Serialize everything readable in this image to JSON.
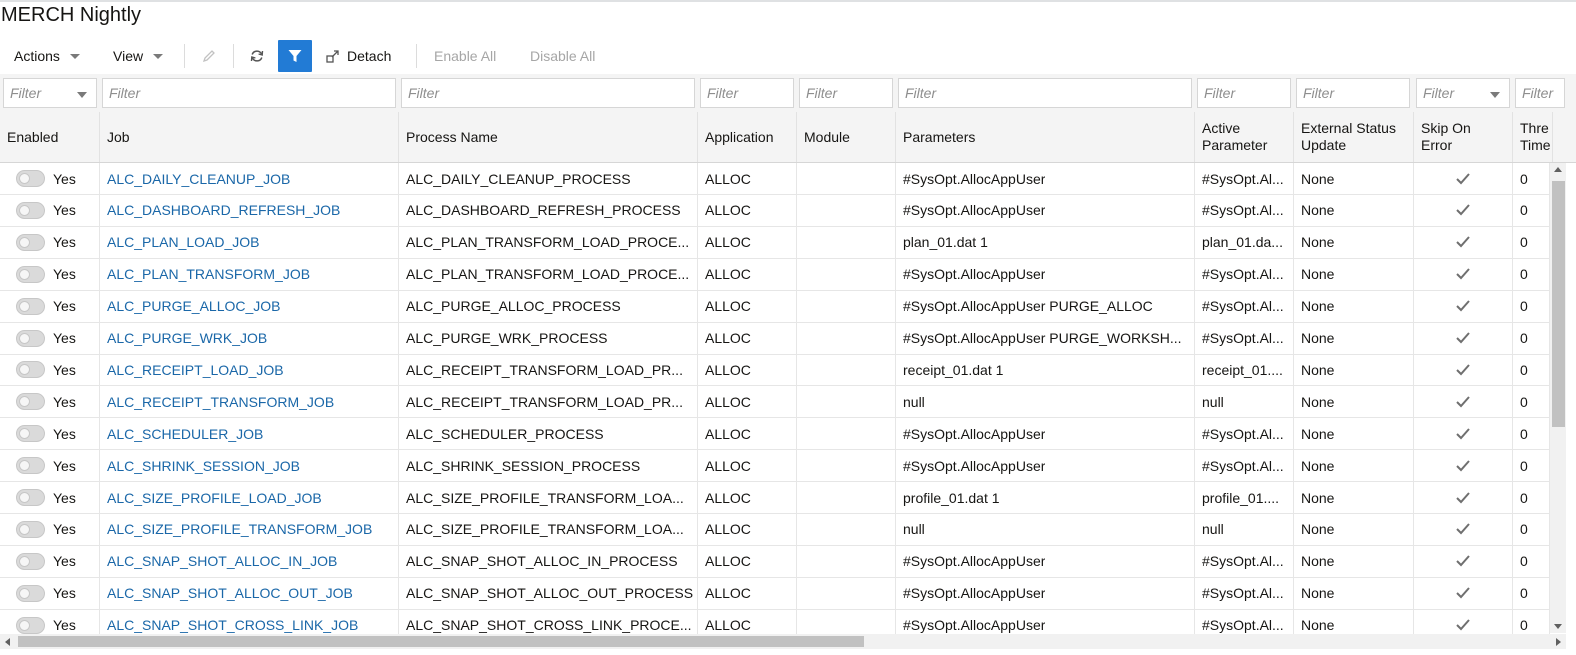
{
  "page": {
    "title": "MERCH Nightly"
  },
  "toolbar": {
    "actions_label": "Actions",
    "view_label": "View",
    "edit_icon": "pencil-icon",
    "refresh_icon": "refresh-icon",
    "filter_icon": "filter-icon",
    "detach_icon": "detach-icon",
    "detach_label": "Detach",
    "enable_all_label": "Enable All",
    "disable_all_label": "Disable All",
    "active_color": "#227bd5"
  },
  "filters": {
    "placeholder": "Filter"
  },
  "columns": {
    "enabled": "Enabled",
    "job": "Job",
    "process_name": "Process Name",
    "application": "Application",
    "module": "Module",
    "parameters": "Parameters",
    "active_parameter_1": "Active",
    "active_parameter_2": "Parameter",
    "external_status_1": "External Status",
    "external_status_2": "Update",
    "skip_on_error_1": "Skip On",
    "skip_on_error_2": "Error",
    "threshold_1": "Thre",
    "threshold_2": "Time"
  },
  "rows": [
    {
      "enabled": "Yes",
      "job": "ALC_DAILY_CLEANUP_JOB",
      "process": "ALC_DAILY_CLEANUP_PROCESS",
      "application": "ALLOC",
      "module": "",
      "parameters": "#SysOpt.AllocAppUser",
      "active_parameter": "#SysOpt.Al...",
      "external_status": "None",
      "skip_on_error": true,
      "threshold": "0"
    },
    {
      "enabled": "Yes",
      "job": "ALC_DASHBOARD_REFRESH_JOB",
      "process": "ALC_DASHBOARD_REFRESH_PROCESS",
      "application": "ALLOC",
      "module": "",
      "parameters": "#SysOpt.AllocAppUser",
      "active_parameter": "#SysOpt.Al...",
      "external_status": "None",
      "skip_on_error": true,
      "threshold": "0"
    },
    {
      "enabled": "Yes",
      "job": "ALC_PLAN_LOAD_JOB",
      "process": "ALC_PLAN_TRANSFORM_LOAD_PROCE...",
      "application": "ALLOC",
      "module": "",
      "parameters": "plan_01.dat 1",
      "active_parameter": "plan_01.da...",
      "external_status": "None",
      "skip_on_error": true,
      "threshold": "0"
    },
    {
      "enabled": "Yes",
      "job": "ALC_PLAN_TRANSFORM_JOB",
      "process": "ALC_PLAN_TRANSFORM_LOAD_PROCE...",
      "application": "ALLOC",
      "module": "",
      "parameters": "#SysOpt.AllocAppUser",
      "active_parameter": "#SysOpt.Al...",
      "external_status": "None",
      "skip_on_error": true,
      "threshold": "0"
    },
    {
      "enabled": "Yes",
      "job": "ALC_PURGE_ALLOC_JOB",
      "process": "ALC_PURGE_ALLOC_PROCESS",
      "application": "ALLOC",
      "module": "",
      "parameters": "#SysOpt.AllocAppUser PURGE_ALLOC",
      "active_parameter": "#SysOpt.Al...",
      "external_status": "None",
      "skip_on_error": true,
      "threshold": "0"
    },
    {
      "enabled": "Yes",
      "job": "ALC_PURGE_WRK_JOB",
      "process": "ALC_PURGE_WRK_PROCESS",
      "application": "ALLOC",
      "module": "",
      "parameters": "#SysOpt.AllocAppUser PURGE_WORKSH...",
      "active_parameter": "#SysOpt.Al...",
      "external_status": "None",
      "skip_on_error": true,
      "threshold": "0"
    },
    {
      "enabled": "Yes",
      "job": "ALC_RECEIPT_LOAD_JOB",
      "process": "ALC_RECEIPT_TRANSFORM_LOAD_PR...",
      "application": "ALLOC",
      "module": "",
      "parameters": "receipt_01.dat 1",
      "active_parameter": "receipt_01....",
      "external_status": "None",
      "skip_on_error": true,
      "threshold": "0"
    },
    {
      "enabled": "Yes",
      "job": "ALC_RECEIPT_TRANSFORM_JOB",
      "process": "ALC_RECEIPT_TRANSFORM_LOAD_PR...",
      "application": "ALLOC",
      "module": "",
      "parameters": "null",
      "active_parameter": "null",
      "external_status": "None",
      "skip_on_error": true,
      "threshold": "0"
    },
    {
      "enabled": "Yes",
      "job": "ALC_SCHEDULER_JOB",
      "process": "ALC_SCHEDULER_PROCESS",
      "application": "ALLOC",
      "module": "",
      "parameters": "#SysOpt.AllocAppUser",
      "active_parameter": "#SysOpt.Al...",
      "external_status": "None",
      "skip_on_error": true,
      "threshold": "0"
    },
    {
      "enabled": "Yes",
      "job": "ALC_SHRINK_SESSION_JOB",
      "process": "ALC_SHRINK_SESSION_PROCESS",
      "application": "ALLOC",
      "module": "",
      "parameters": "#SysOpt.AllocAppUser",
      "active_parameter": "#SysOpt.Al...",
      "external_status": "None",
      "skip_on_error": true,
      "threshold": "0"
    },
    {
      "enabled": "Yes",
      "job": "ALC_SIZE_PROFILE_LOAD_JOB",
      "process": "ALC_SIZE_PROFILE_TRANSFORM_LOA...",
      "application": "ALLOC",
      "module": "",
      "parameters": "profile_01.dat 1",
      "active_parameter": "profile_01....",
      "external_status": "None",
      "skip_on_error": true,
      "threshold": "0"
    },
    {
      "enabled": "Yes",
      "job": "ALC_SIZE_PROFILE_TRANSFORM_JOB",
      "process": "ALC_SIZE_PROFILE_TRANSFORM_LOA...",
      "application": "ALLOC",
      "module": "",
      "parameters": "null",
      "active_parameter": "null",
      "external_status": "None",
      "skip_on_error": true,
      "threshold": "0"
    },
    {
      "enabled": "Yes",
      "job": "ALC_SNAP_SHOT_ALLOC_IN_JOB",
      "process": "ALC_SNAP_SHOT_ALLOC_IN_PROCESS",
      "application": "ALLOC",
      "module": "",
      "parameters": "#SysOpt.AllocAppUser",
      "active_parameter": "#SysOpt.Al...",
      "external_status": "None",
      "skip_on_error": true,
      "threshold": "0"
    },
    {
      "enabled": "Yes",
      "job": "ALC_SNAP_SHOT_ALLOC_OUT_JOB",
      "process": "ALC_SNAP_SHOT_ALLOC_OUT_PROCESS",
      "application": "ALLOC",
      "module": "",
      "parameters": "#SysOpt.AllocAppUser",
      "active_parameter": "#SysOpt.Al...",
      "external_status": "None",
      "skip_on_error": true,
      "threshold": "0"
    },
    {
      "enabled": "Yes",
      "job": "ALC_SNAP_SHOT_CROSS_LINK_JOB",
      "process": "ALC_SNAP_SHOT_CROSS_LINK_PROCE...",
      "application": "ALLOC",
      "module": "",
      "parameters": "#SysOpt.AllocAppUser",
      "active_parameter": "#SysOpt.Al...",
      "external_status": "None",
      "skip_on_error": true,
      "threshold": "0"
    }
  ]
}
